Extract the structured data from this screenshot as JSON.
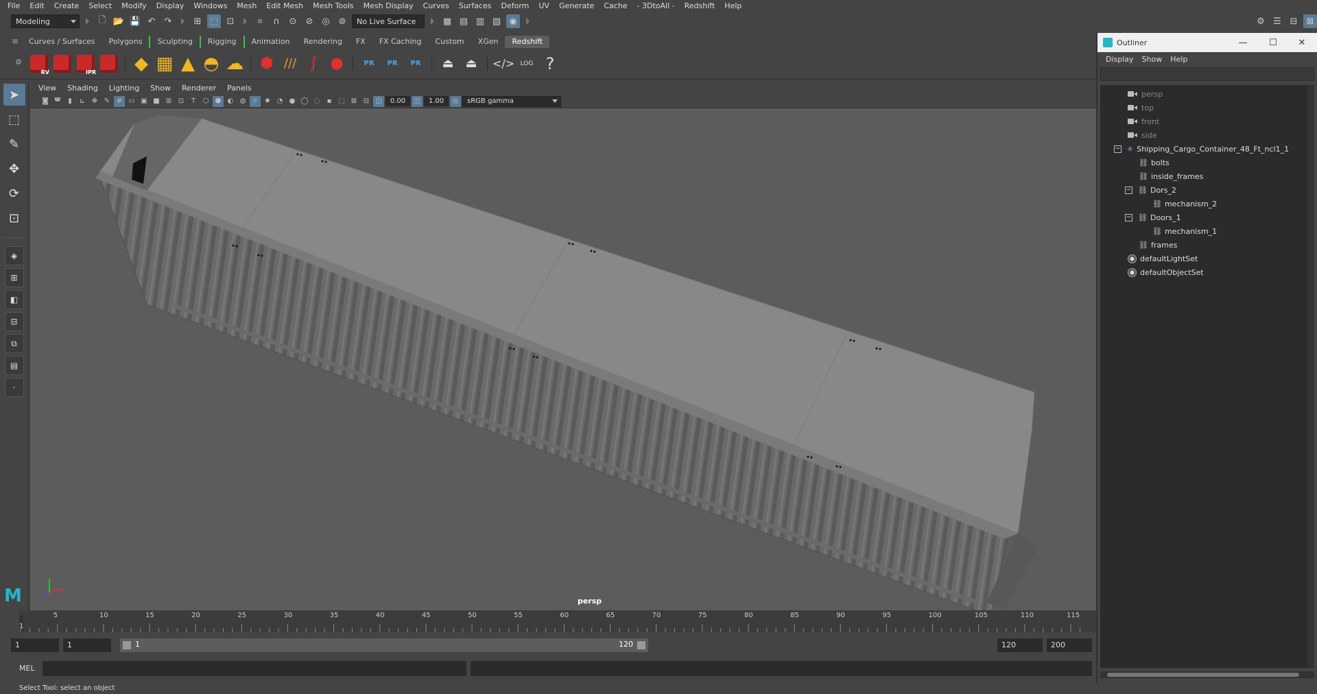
{
  "menubar": [
    "File",
    "Edit",
    "Create",
    "Select",
    "Modify",
    "Display",
    "Windows",
    "Mesh",
    "Edit Mesh",
    "Mesh Tools",
    "Mesh Display",
    "Curves",
    "Surfaces",
    "Deform",
    "UV",
    "Generate",
    "Cache",
    "- 3DtoAll -",
    "Redshift",
    "Help"
  ],
  "statusline": {
    "mode": "Modeling",
    "live_surface": "No Live Surface"
  },
  "shelf_tabs": [
    "Curves / Surfaces",
    "Polygons",
    "Sculpting",
    "Rigging",
    "Animation",
    "Rendering",
    "FX",
    "FX Caching",
    "Custom",
    "XGen",
    "Redshift"
  ],
  "shelf_selected": "Redshift",
  "shelf_icons": {
    "rv": "RV",
    "ipr": "IPR",
    "pr": "PR",
    "log": "LOG",
    "help": "?"
  },
  "panel_menu": [
    "View",
    "Shading",
    "Lighting",
    "Show",
    "Renderer",
    "Panels"
  ],
  "panel_tools": {
    "exposure": "0.00",
    "gamma": "1.00",
    "color_space": "sRGB gamma"
  },
  "viewport": {
    "camera_label": "persp"
  },
  "timeslider": {
    "ticks": [
      "5",
      "10",
      "15",
      "20",
      "25",
      "30",
      "35",
      "40",
      "45",
      "50",
      "55",
      "60",
      "65",
      "70",
      "75",
      "80",
      "85",
      "90",
      "95",
      "100",
      "105",
      "110",
      "115"
    ],
    "current": "1"
  },
  "range": {
    "start": "1",
    "playback_start": "1",
    "range_left": "1",
    "range_right": "120",
    "playback_end": "120",
    "end": "200"
  },
  "cmdline": {
    "label": "MEL"
  },
  "helpline": "Select Tool: select an object",
  "outliner": {
    "title": "Outliner",
    "menu": [
      "Display",
      "Show",
      "Help"
    ],
    "cameras": [
      "persp",
      "top",
      "front",
      "side"
    ],
    "root": "Shipping_Cargo_Container_48_Ft_ncl1_1",
    "children": [
      {
        "label": "bolts"
      },
      {
        "label": "inside_frames"
      },
      {
        "label": "Dors_2"
      },
      {
        "label": "mechanism_2"
      },
      {
        "label": "Doors_1"
      },
      {
        "label": "mechanism_1"
      },
      {
        "label": "frames"
      }
    ],
    "sets": [
      "defaultLightSet",
      "defaultObjectSet"
    ]
  },
  "colors": {
    "accent": "#5a7a95",
    "maya_teal": "#23b7c9",
    "redshift_red": "#c82a2a"
  }
}
